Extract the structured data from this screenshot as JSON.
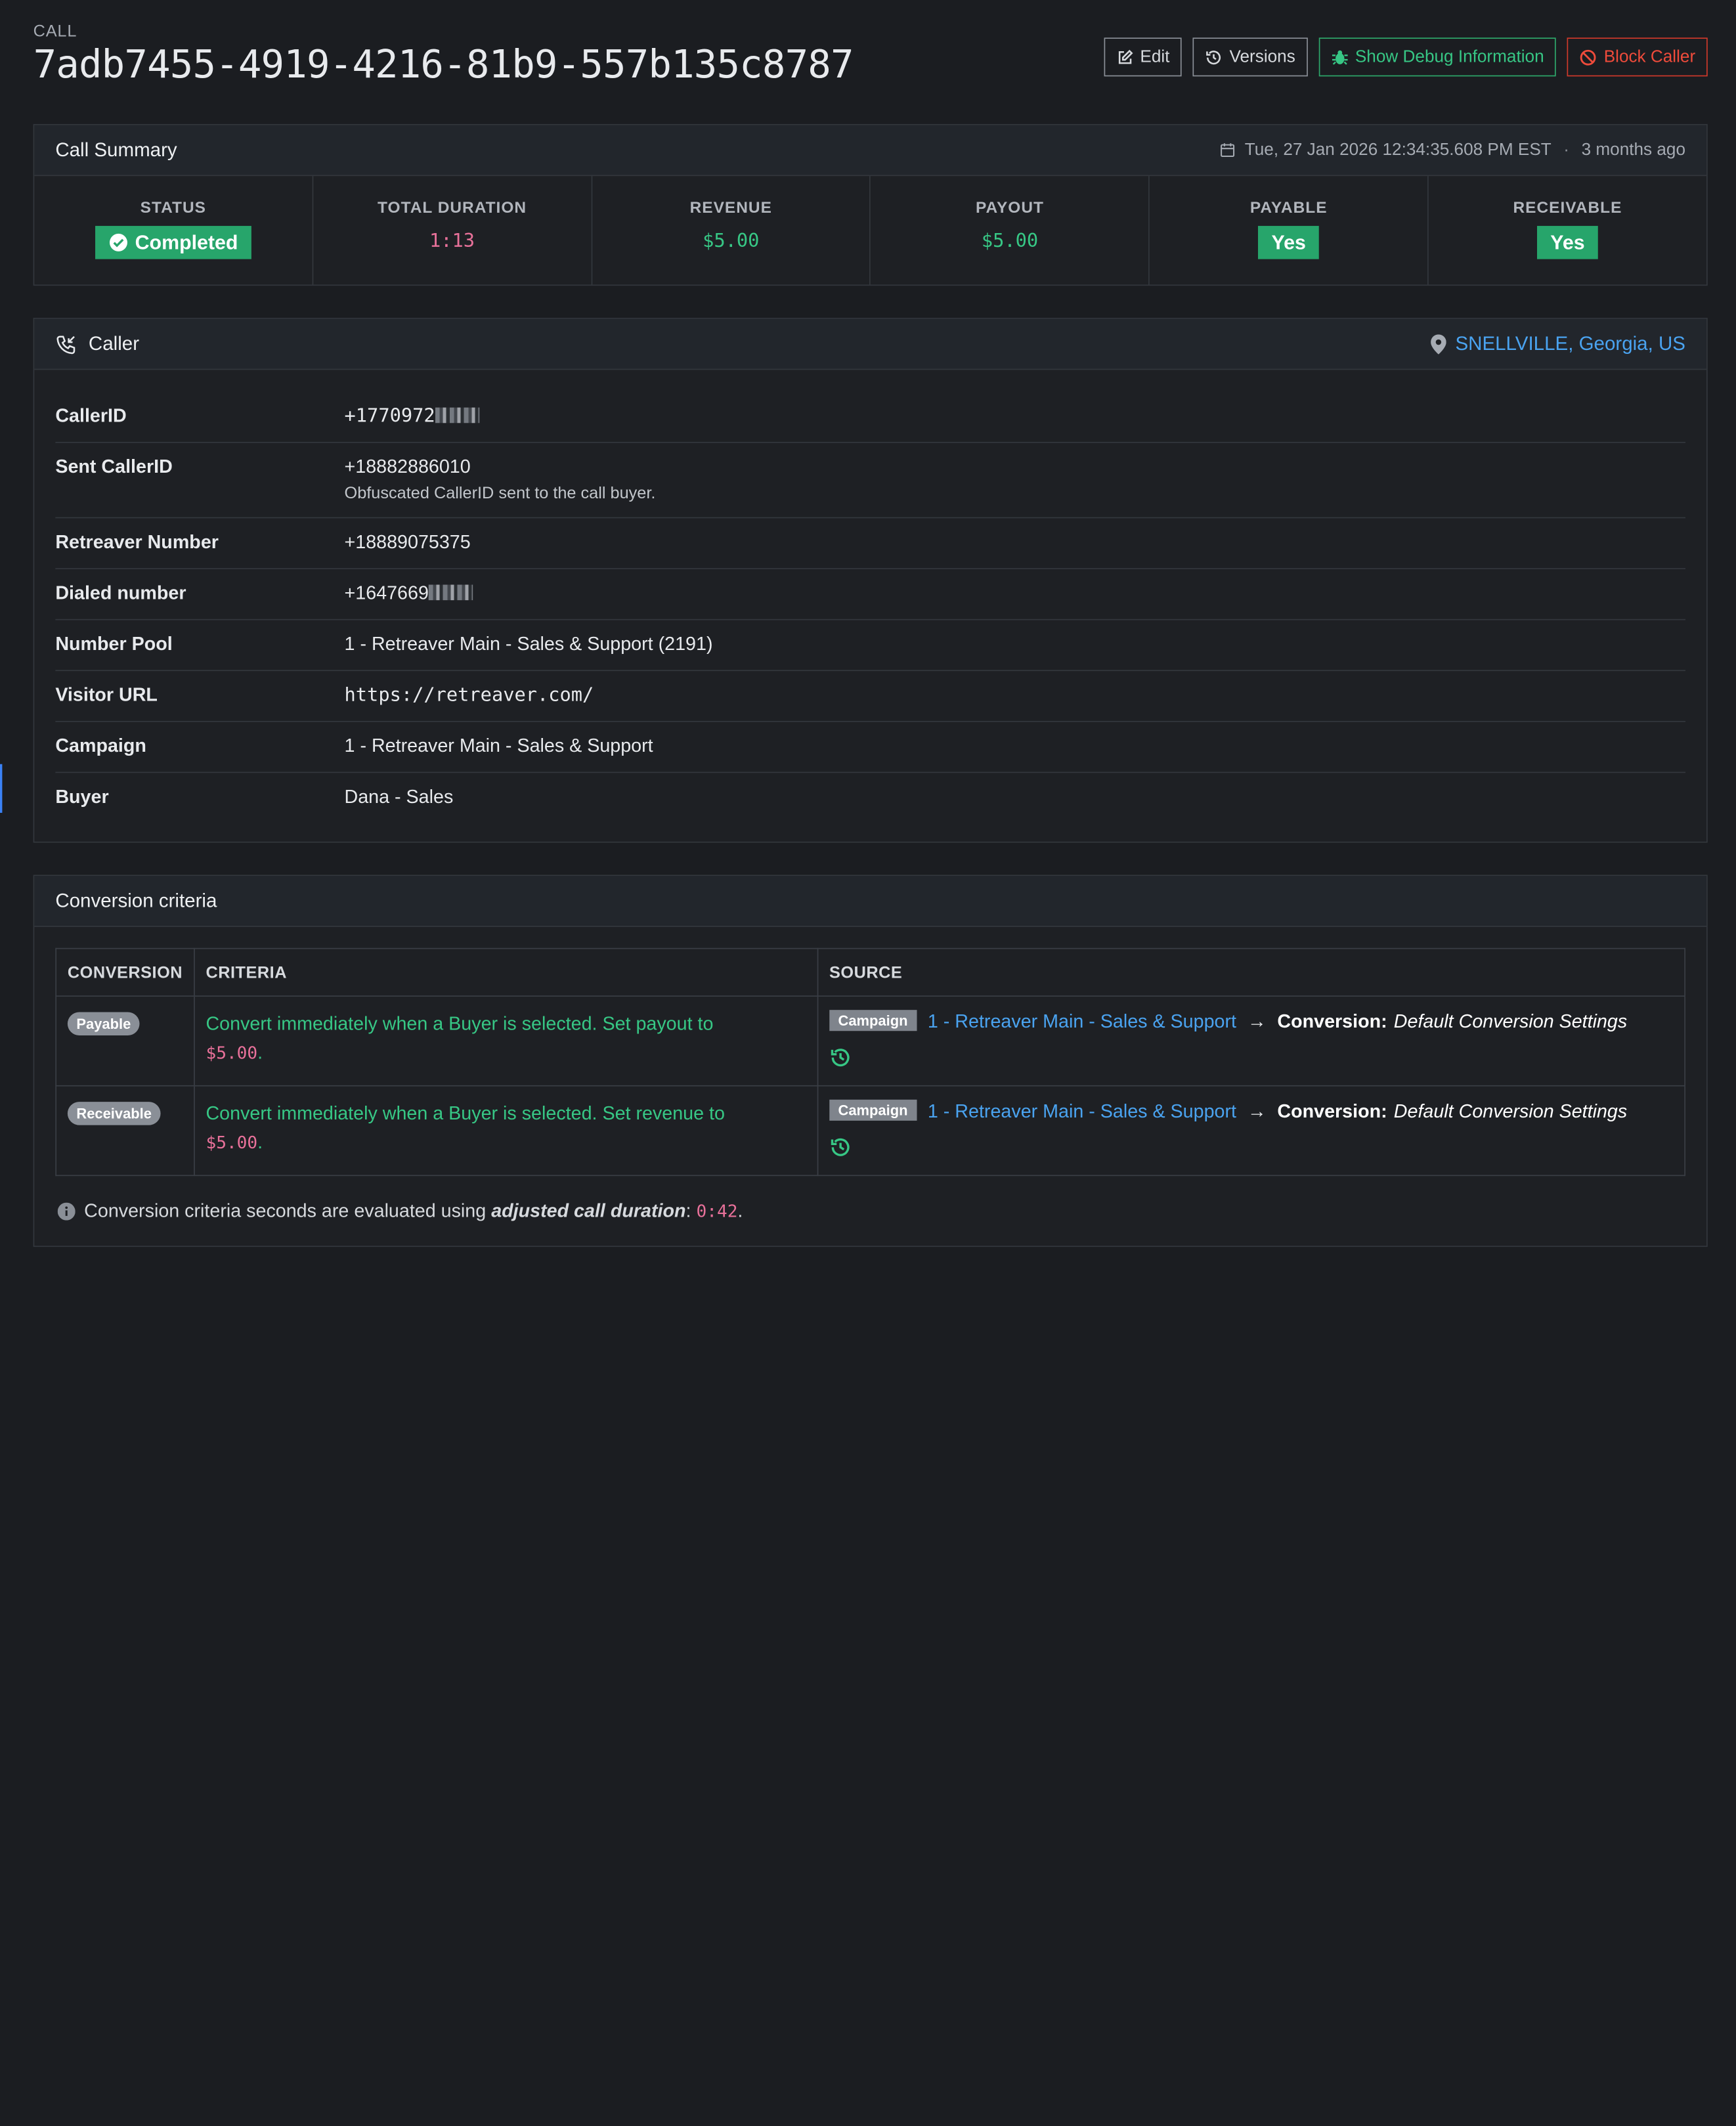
{
  "header": {
    "eyebrow": "CALL",
    "call_id": "7adb7455-4919-4216-81b9-557b135c8787",
    "buttons": {
      "edit": "Edit",
      "versions": "Versions",
      "debug": "Show Debug Information",
      "block": "Block Caller"
    }
  },
  "summary": {
    "title": "Call Summary",
    "timestamp": "Tue, 27 Jan 2026 12:34:35.608 PM EST",
    "relative": "3 months ago",
    "stats": {
      "status_label": "STATUS",
      "status_value": "Completed",
      "duration_label": "TOTAL DURATION",
      "duration_value": "1:13",
      "revenue_label": "REVENUE",
      "revenue_value": "$5.00",
      "payout_label": "PAYOUT",
      "payout_value": "$5.00",
      "payable_label": "PAYABLE",
      "payable_value": "Yes",
      "receivable_label": "RECEIVABLE",
      "receivable_value": "Yes"
    }
  },
  "caller": {
    "title": "Caller",
    "location": "SNELLVILLE, Georgia, US",
    "rows": {
      "callerid_label": "CallerID",
      "callerid_value": "+1770972",
      "sent_label": "Sent CallerID",
      "sent_value": "+18882886010",
      "sent_note": "Obfuscated CallerID sent to the call buyer.",
      "retreaver_label": "Retreaver Number",
      "retreaver_value": "+18889075375",
      "dialed_label": "Dialed number",
      "dialed_value": "+1647669",
      "pool_label": "Number Pool",
      "pool_value": "1 - Retreaver Main - Sales & Support (2191)",
      "url_label": "Visitor URL",
      "url_value": "https://retreaver.com/",
      "campaign_label": "Campaign",
      "campaign_value": "1 - Retreaver Main - Sales & Support",
      "buyer_label": "Buyer",
      "buyer_value": "Dana - Sales"
    }
  },
  "conversion": {
    "title": "Conversion criteria",
    "columns": {
      "c1": "CONVERSION",
      "c2": "CRITERIA",
      "c3": "SOURCE"
    },
    "rows": [
      {
        "type": "Payable",
        "criteria_text": "Convert immediately when a Buyer is selected. Set payout to",
        "criteria_amount": "$5.00",
        "source_tag": "Campaign",
        "source_link": "1 - Retreaver Main - Sales & Support",
        "conv_label": "Conversion:",
        "conv_value": "Default Conversion Settings"
      },
      {
        "type": "Receivable",
        "criteria_text": "Convert immediately when a Buyer is selected. Set revenue to",
        "criteria_amount": "$5.00",
        "source_tag": "Campaign",
        "source_link": "1 - Retreaver Main - Sales & Support",
        "conv_label": "Conversion:",
        "conv_value": "Default Conversion Settings"
      }
    ],
    "note_prefix": "Conversion criteria seconds are evaluated using",
    "note_emph": "adjusted call duration",
    "note_value": "0:42"
  }
}
